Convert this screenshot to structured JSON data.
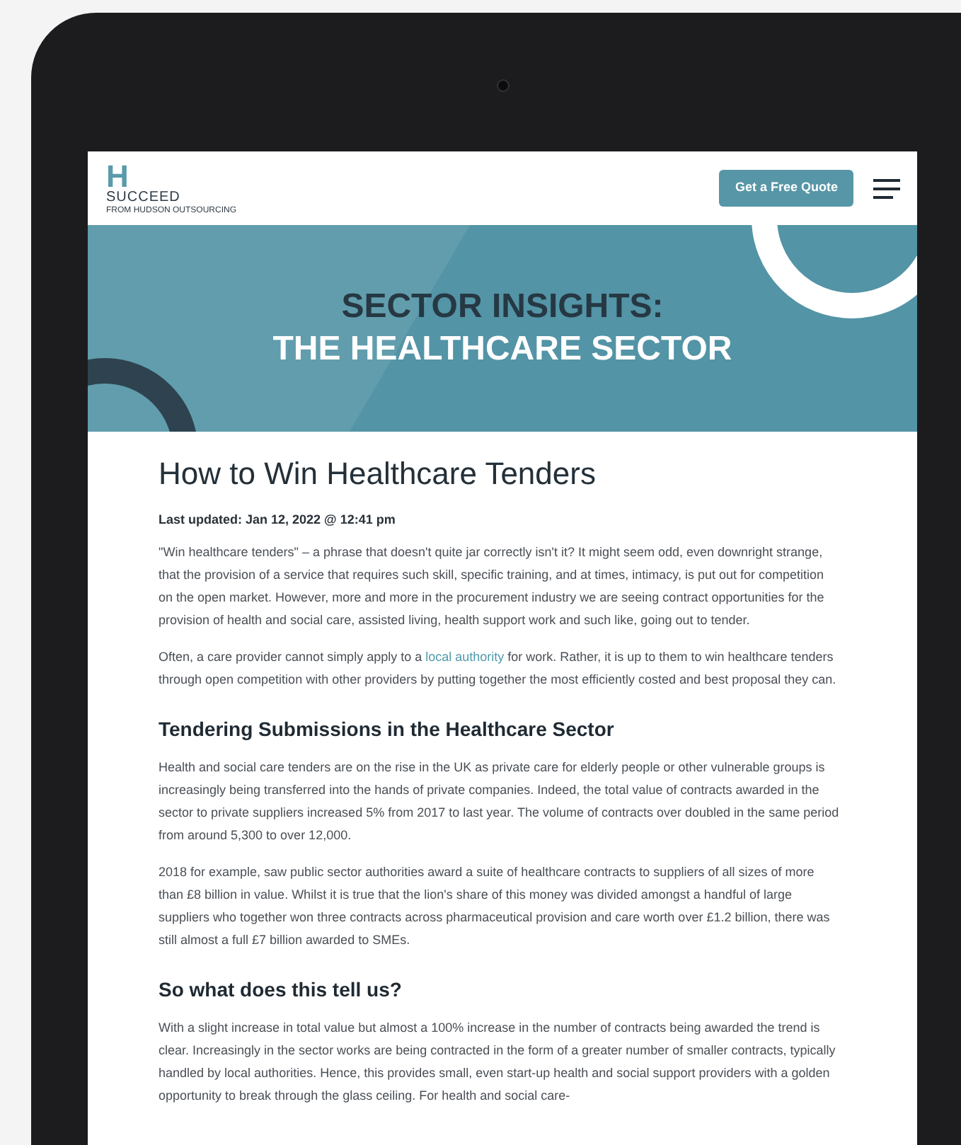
{
  "header": {
    "logo": {
      "mark": "H",
      "name": "SUCCEED",
      "tagline": "FROM HUDSON OUTSOURCING"
    },
    "cta_button": "Get a Free Quote"
  },
  "hero": {
    "line_1": "SECTOR INSIGHTS:",
    "line_2": "THE HEALTHCARE SECTOR"
  },
  "article": {
    "title": "How to Win Healthcare Tenders",
    "updated": "Last updated: Jan 12, 2022 @ 12:41 pm",
    "blocks": [
      {
        "kind": "paragraph",
        "parts": [
          {
            "text": "\"Win healthcare tenders\" – a phrase that doesn't quite jar correctly isn't it? It might seem odd, even downright strange, that the provision of a service that requires such skill, specific training, and at times, intimacy, is put out for competition on the open market. However, more and more in the procurement industry we are seeing contract opportunities for the provision of health and social care, assisted living, health support work and such like, going out to tender."
          }
        ]
      },
      {
        "kind": "paragraph",
        "parts": [
          {
            "kind": "text",
            "text": "Often, a care provider cannot simply apply to a "
          },
          {
            "kind": "link",
            "text": "local authority"
          },
          {
            "kind": "text",
            "text": " for work. Rather, it is up to them to win healthcare tenders through open competition with other providers by putting together the most efficiently costed and best proposal they can."
          }
        ]
      },
      {
        "kind": "heading",
        "text": "Tendering Submissions in the Healthcare Sector"
      },
      {
        "kind": "paragraph",
        "parts": [
          {
            "text": "Health and social care tenders are on the rise in the UK as private care for elderly people or other vulnerable groups is increasingly being transferred into the hands of private companies. Indeed, the total value of contracts awarded in the sector to private suppliers increased 5% from 2017 to last year. The volume of contracts over doubled in the same period from around 5,300 to over 12,000."
          }
        ]
      },
      {
        "kind": "paragraph",
        "parts": [
          {
            "text": "2018 for example, saw public sector authorities award a suite of healthcare contracts to suppliers of all sizes of more than £8 billion in value. Whilst it is true that the lion's share of this money was divided amongst a handful of large suppliers who together won three contracts across pharmaceutical provision and care worth over £1.2 billion, there was still almost a full £7 billion awarded to SMEs."
          }
        ]
      },
      {
        "kind": "heading",
        "text": "So what does this tell us?"
      },
      {
        "kind": "paragraph",
        "parts": [
          {
            "text": "With a slight increase in total value but almost a 100% increase in the number of contracts being awarded the trend is clear. Increasingly in the sector works are being contracted in the form of a greater number of smaller contracts, typically handled by local authorities. Hence, this provides small, even start-up health and social support providers with a golden opportunity to break through the glass ceiling. For health and social care-"
          }
        ]
      }
    ]
  }
}
